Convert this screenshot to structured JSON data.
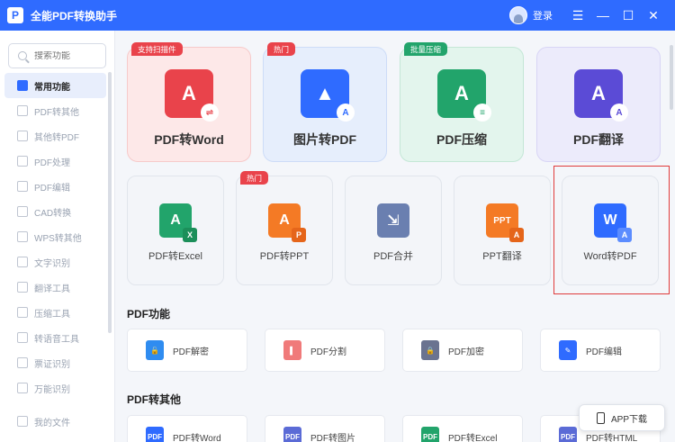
{
  "app": {
    "title": "全能PDF转换助手",
    "logo_glyph": "P"
  },
  "titlebar": {
    "login_label": "登录",
    "menu_glyph": "☰",
    "minimize_glyph": "—",
    "maximize_glyph": "☐",
    "close_glyph": "✕"
  },
  "search": {
    "placeholder": "搜索功能"
  },
  "sidebar": {
    "items": [
      {
        "label": "常用功能",
        "active": true
      },
      {
        "label": "PDF转其他"
      },
      {
        "label": "其他转PDF"
      },
      {
        "label": "PDF处理"
      },
      {
        "label": "PDF编辑"
      },
      {
        "label": "CAD转换"
      },
      {
        "label": "WPS转其他"
      },
      {
        "label": "文字识别"
      },
      {
        "label": "翻译工具"
      },
      {
        "label": "压缩工具"
      },
      {
        "label": "转语音工具"
      },
      {
        "label": "票证识别"
      },
      {
        "label": "万能识别"
      }
    ],
    "my_files": "我的文件"
  },
  "big_cards": [
    {
      "label": "PDF转Word",
      "tag": "支持扫描件",
      "icon": "pdf-to-word-icon",
      "glyph": "A",
      "sub": "⇌",
      "bg": "#fde8e8",
      "border": "#f6caca",
      "icon_color": "#e9434b",
      "tag_color": "#e9434b"
    },
    {
      "label": "图片转PDF",
      "tag": "热门",
      "icon": "image-to-pdf-icon",
      "glyph": "▲",
      "sub": "A",
      "bg": "#e6eefc",
      "border": "#cddcf7",
      "icon_color": "#2f6bff",
      "tag_color": "#e9434b"
    },
    {
      "label": "PDF压缩",
      "tag": "批量压缩",
      "icon": "pdf-compress-icon",
      "glyph": "A",
      "sub": "≡",
      "bg": "#e3f5ed",
      "border": "#c4e7d6",
      "icon_color": "#22a46b",
      "tag_color": "#22a46b"
    },
    {
      "label": "PDF翻译",
      "tag": "",
      "icon": "pdf-translate-icon",
      "glyph": "A",
      "sub": "A",
      "bg": "#ecebfb",
      "border": "#d8d5f5",
      "icon_color": "#5b4bd6",
      "tag_color": ""
    }
  ],
  "mid_cards": [
    {
      "label": "PDF转Excel",
      "tag": "",
      "icon": "pdf-to-excel-icon",
      "glyph": "A",
      "badge": "X",
      "icon_color": "#22a46b",
      "badge_color": "#1c8f5a"
    },
    {
      "label": "PDF转PPT",
      "tag": "热门",
      "icon": "pdf-to-ppt-icon",
      "glyph": "A",
      "badge": "P",
      "icon_color": "#f47a25",
      "badge_color": "#e5651a"
    },
    {
      "label": "PDF合并",
      "tag": "",
      "icon": "pdf-merge-icon",
      "glyph": "⇲",
      "badge": "",
      "icon_color": "#6a7fb0",
      "badge_color": ""
    },
    {
      "label": "PPT翻译",
      "tag": "",
      "icon": "ppt-translate-icon",
      "glyph": "PPT",
      "badge": "A",
      "icon_color": "#f47a25",
      "badge_color": "#e5651a"
    },
    {
      "label": "Word转PDF",
      "tag": "",
      "icon": "word-to-pdf-icon",
      "glyph": "W",
      "badge": "A",
      "icon_color": "#2f6bff",
      "badge_color": "#5b8cff"
    }
  ],
  "sections": {
    "pdf_functions": {
      "title": "PDF功能",
      "items": [
        {
          "label": "PDF解密",
          "icon": "unlock-icon",
          "color": "#2f8cf0",
          "glyph": "🔓"
        },
        {
          "label": "PDF分割",
          "icon": "split-icon",
          "color": "#f07a7a",
          "glyph": "▌"
        },
        {
          "label": "PDF加密",
          "icon": "lock-icon",
          "color": "#6a7390",
          "glyph": "🔒"
        },
        {
          "label": "PDF编辑",
          "icon": "edit-icon",
          "color": "#2f6bff",
          "glyph": "✎"
        }
      ]
    },
    "pdf_to_other": {
      "title": "PDF转其他",
      "items": [
        {
          "label": "PDF转Word",
          "icon": "pdf-word-small-icon",
          "color": "#2f6bff",
          "glyph": "PDF"
        },
        {
          "label": "PDF转图片",
          "icon": "pdf-image-small-icon",
          "color": "#5b6bd6",
          "glyph": "PDF"
        },
        {
          "label": "PDF转Excel",
          "icon": "pdf-excel-small-icon",
          "color": "#22a46b",
          "glyph": "PDF"
        },
        {
          "label": "PDF转HTML",
          "icon": "pdf-html-small-icon",
          "color": "#5b6bd6",
          "glyph": "PDF"
        }
      ]
    }
  },
  "app_download": {
    "label": "APP下载"
  }
}
